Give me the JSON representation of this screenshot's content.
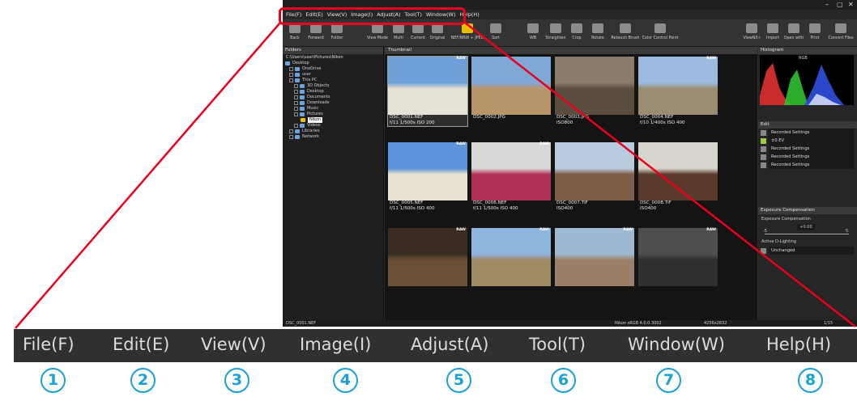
{
  "menu": {
    "items": [
      "File(F)",
      "Edit(E)",
      "View(V)",
      "Image(I)",
      "Adjust(A)",
      "Tool(T)",
      "Window(W)",
      "Help(H)"
    ],
    "callout_numbers": [
      "1",
      "2",
      "3",
      "4",
      "5",
      "6",
      "7",
      "8"
    ]
  },
  "toolbar": {
    "buttons": [
      "Back",
      "Forward",
      "Folder",
      "View Mode",
      "Multi",
      "Current",
      "Original",
      "NEF/NRW + JPEG",
      "Sort",
      "WB",
      "Straighten",
      "Crop",
      "Rotate",
      "Retouch Brush",
      "Color Control Point",
      "ViewNX-i",
      "Import",
      "Open with",
      "Print",
      "Convert Files"
    ]
  },
  "folders_panel": {
    "title": "Folders",
    "path": "C:\\Users\\user\\Pictures\\Nikon",
    "tree": [
      "Desktop",
      "OneDrive",
      "user",
      "This PC",
      "3D Objects",
      "Desktop",
      "Documents",
      "Downloads",
      "Music",
      "Pictures",
      "Nikon",
      "Videos",
      "Libraries",
      "Network"
    ]
  },
  "thumbnail_panel": {
    "title": "Thumbnail",
    "images": [
      {
        "name": "DSC_0001.NEF",
        "info": "f/11 1/500s ISO 200",
        "raw": "RAW",
        "sky": "#6e9fd8",
        "ground": "#e6e1d6"
      },
      {
        "name": "DSC_0002.JPG",
        "info": "",
        "raw": "",
        "sky": "#7fa8d6",
        "ground": "#b7956a"
      },
      {
        "name": "DSC_0003.JPG",
        "info": "ISO800",
        "raw": "",
        "sky": "#8a7b6a",
        "ground": "#5a4c3e"
      },
      {
        "name": "DSC_0004.NEF",
        "info": "f/10 1/400s ISO 400",
        "raw": "RAW",
        "sky": "#9cbbe0",
        "ground": "#9a8d72"
      },
      {
        "name": "DSC_0005.NEF",
        "info": "f/11 1/500s ISO 400",
        "raw": "RAW",
        "sky": "#5d93d8",
        "ground": "#e8e2d0"
      },
      {
        "name": "DSC_0006.NEF",
        "info": "f/11 1/500s ISO 400",
        "raw": "RAW",
        "sky": "#d7d7d7",
        "ground": "#b02f55"
      },
      {
        "name": "DSC_0007.TIF",
        "info": "ISO400",
        "raw": "",
        "sky": "#b9ccdf",
        "ground": "#7e5c46"
      },
      {
        "name": "DSC_0008.TIF",
        "info": "ISO400",
        "raw": "",
        "sky": "#d8d5cc",
        "ground": "#5b3a2c"
      },
      {
        "name": "",
        "info": "",
        "raw": "RAW",
        "sky": "#3a2c22",
        "ground": "#6a5036"
      },
      {
        "name": "",
        "info": "",
        "raw": "RAW",
        "sky": "#8fb4de",
        "ground": "#a08a66"
      },
      {
        "name": "",
        "info": "",
        "raw": "RAW",
        "sky": "#9fb9d2",
        "ground": "#9c7f68"
      },
      {
        "name": "",
        "info": "",
        "raw": "RAW",
        "sky": "#4e4e4e",
        "ground": "#2f2f2f"
      }
    ]
  },
  "right_panel": {
    "histogram_title": "Histogram",
    "histogram_channel": "RGB",
    "edit_title": "Edit",
    "edit_rows": [
      "Recorded Settings",
      "±0 EV",
      "Recorded Settings",
      "Recorded Settings",
      "Recorded Settings"
    ],
    "exposure_title": "Exposure Compensation",
    "exposure_label": "Exposure Compensation",
    "exposure_value": "+0.00",
    "scale_min": "-5",
    "scale_max": "5",
    "adl_label": "Active D-Lighting",
    "adl_value": "Unchanged"
  },
  "status": {
    "file": "DSC_0001.NEF",
    "profile": "Nikon sRGB 4.0.0.3002",
    "dimensions": "4256x2832",
    "page": "1/15"
  },
  "colors": {
    "callout": "#e8001d",
    "number": "#1aa0d8",
    "menubar": "#303030"
  }
}
